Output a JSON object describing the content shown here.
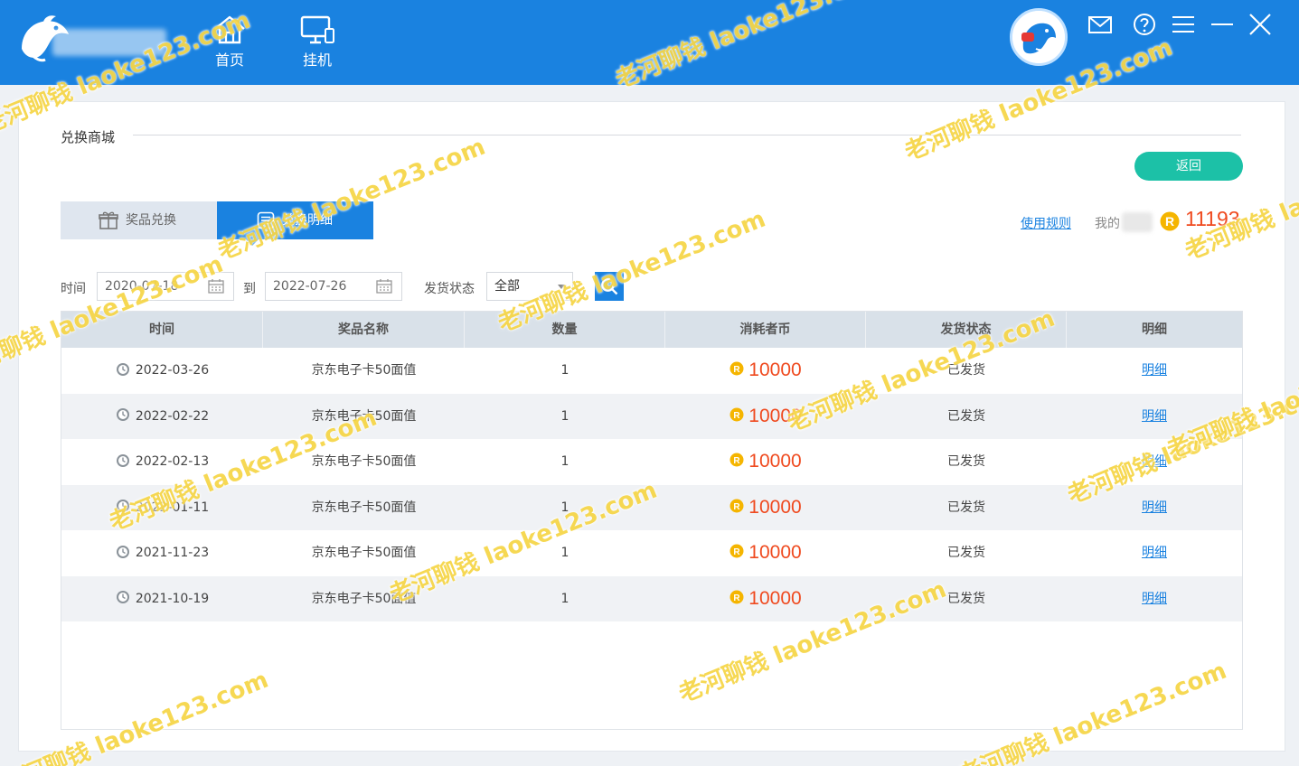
{
  "titlebar": {
    "nav": [
      {
        "label": "首页",
        "icon": "home-icon"
      },
      {
        "label": "挂机",
        "icon": "monitor-icon"
      }
    ]
  },
  "panel": {
    "section_title": "兑换商城",
    "back_label": "返回",
    "tabs": [
      {
        "label": "奖品兑换",
        "icon": "gift-icon",
        "active": false
      },
      {
        "label": "兑换明细",
        "icon": "list-icon",
        "active": true
      }
    ],
    "rules_link": "使用规则",
    "my_label": "我的",
    "balance": "11193"
  },
  "filters": {
    "time_label": "时间",
    "start_date": "2020-07-18",
    "to_label": "到",
    "end_date": "2022-07-26",
    "status_label": "发货状态",
    "status_value": "全部"
  },
  "table": {
    "headers": [
      "时间",
      "奖品名称",
      "数量",
      "消耗者币",
      "发货状态",
      "明细"
    ],
    "rows": [
      {
        "date": "2022-03-26",
        "name": "京东电子卡50面值",
        "qty": "1",
        "cost": "10000",
        "status": "已发货",
        "detail": "明细"
      },
      {
        "date": "2022-02-22",
        "name": "京东电子卡50面值",
        "qty": "1",
        "cost": "10000",
        "status": "已发货",
        "detail": "明细"
      },
      {
        "date": "2022-02-13",
        "name": "京东电子卡50面值",
        "qty": "1",
        "cost": "10000",
        "status": "已发货",
        "detail": "明细"
      },
      {
        "date": "2022-01-11",
        "name": "京东电子卡50面值",
        "qty": "1",
        "cost": "10000",
        "status": "已发货",
        "detail": "明细"
      },
      {
        "date": "2021-11-23",
        "name": "京东电子卡50面值",
        "qty": "1",
        "cost": "10000",
        "status": "已发货",
        "detail": "明细"
      },
      {
        "date": "2021-10-19",
        "name": "京东电子卡50面值",
        "qty": "1",
        "cost": "10000",
        "status": "已发货",
        "detail": "明细"
      }
    ]
  },
  "watermark": {
    "text": "老河聊钱 laoke123.com"
  },
  "colors": {
    "brand_blue": "#1a82e0",
    "back_green": "#1cc1a7",
    "coin_orange": "#ef4a1f",
    "coin_gold": "#f5b500"
  }
}
